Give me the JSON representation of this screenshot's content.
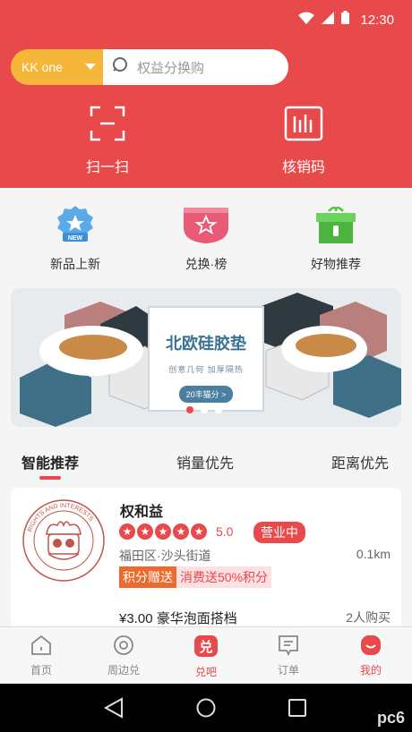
{
  "status": {
    "time": "12:30"
  },
  "search": {
    "city": "KK one",
    "placeholder": "权益分换购"
  },
  "header_actions": [
    {
      "label": "扫一扫",
      "icon": "scan-icon"
    },
    {
      "label": "核销码",
      "icon": "barcode-icon"
    }
  ],
  "quick_links": [
    {
      "label": "新品上新",
      "icon": "new-badge-icon",
      "badge": "NEW"
    },
    {
      "label": "兑换·榜",
      "icon": "ranking-icon"
    },
    {
      "label": "好物推荐",
      "icon": "gift-box-icon"
    }
  ],
  "banner": {
    "title": "北欧硅胶垫",
    "subtitle": "创意几何 加厚隔热",
    "button": "20丰猫分 >",
    "slides": 3,
    "active_slide": 1
  },
  "tabs": [
    "智能推荐",
    "销量优先",
    "距离优先"
  ],
  "store": {
    "name": "权和益",
    "rating": "5.0",
    "stars": 5,
    "status": "营业中",
    "address": "福田区·沙头街道",
    "distance": "0.1km",
    "tag_primary": "积分赠送",
    "tag_secondary": "消费送50%积分",
    "deal": "¥3.00 豪华泡面搭档",
    "deal_count": "2人购买",
    "logo_text": "RIGHTS AND INTERESTS"
  },
  "bottom_nav": [
    {
      "label": "首页",
      "icon": "home-icon"
    },
    {
      "label": "周边兑",
      "icon": "nearby-icon"
    },
    {
      "label": "兑吧",
      "icon": "dui-icon",
      "glyph": "兑"
    },
    {
      "label": "订单",
      "icon": "order-icon"
    },
    {
      "label": "我的",
      "icon": "profile-icon"
    }
  ],
  "watermark": "pc6",
  "colors": {
    "primary": "#e8494a",
    "accent": "#f5b63a",
    "tag_orange": "#ec6a2d"
  }
}
